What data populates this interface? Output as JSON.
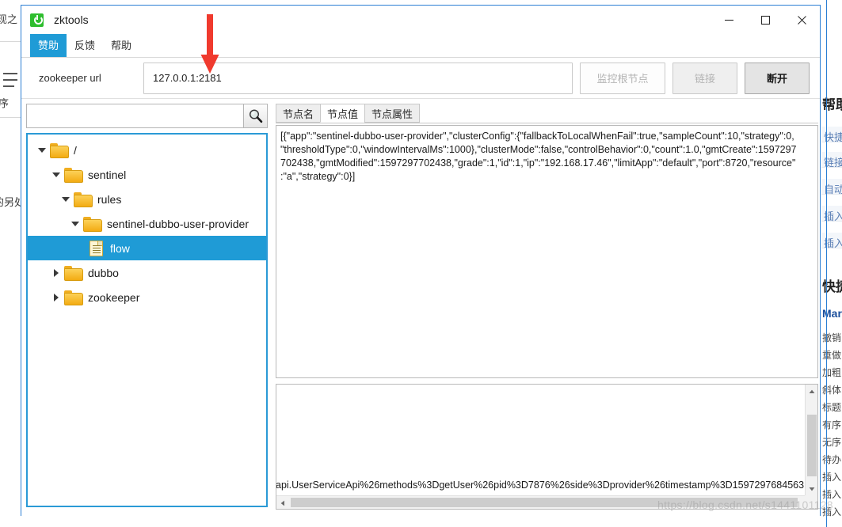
{
  "window": {
    "title": "zktools",
    "logo_icon": "zk-logo-icon",
    "controls": {
      "minimize": "minimize-icon",
      "maximize": "maximize-icon",
      "close": "close-icon"
    }
  },
  "menubar": {
    "items": [
      {
        "label": "赞助",
        "active": true
      },
      {
        "label": "反馈",
        "active": false
      },
      {
        "label": "帮助",
        "active": false
      }
    ]
  },
  "toolbar": {
    "url_label": "zookeeper url",
    "url_value": "127.0.0.1:2181",
    "url_placeholder": "",
    "watch_root_label": "监控根节点",
    "connect_label": "链接",
    "disconnect_label": "断开"
  },
  "sidebar": {
    "search_value": "",
    "search_placeholder": "",
    "search_icon": "magnifier-icon",
    "tree": [
      {
        "label": "/",
        "depth": 0,
        "type": "folder",
        "expanded": true,
        "selected": false
      },
      {
        "label": "sentinel",
        "depth": 1,
        "type": "folder",
        "expanded": true,
        "selected": false
      },
      {
        "label": "rules",
        "depth": 2,
        "type": "folder",
        "expanded": true,
        "selected": false
      },
      {
        "label": "sentinel-dubbo-user-provider",
        "depth": 3,
        "type": "folder",
        "expanded": true,
        "selected": false
      },
      {
        "label": "flow",
        "depth": 4,
        "type": "file",
        "expanded": false,
        "selected": true
      },
      {
        "label": "dubbo",
        "depth": 1,
        "type": "folder",
        "expanded": false,
        "selected": false
      },
      {
        "label": "zookeeper",
        "depth": 1,
        "type": "folder",
        "expanded": false,
        "selected": false
      }
    ]
  },
  "content": {
    "tabs": [
      {
        "label": "节点名",
        "active": false
      },
      {
        "label": "节点值",
        "active": true
      },
      {
        "label": "节点属性",
        "active": false
      }
    ],
    "node_value": "[{\"app\":\"sentinel-dubbo-user-provider\",\"clusterConfig\":{\"fallbackToLocalWhenFail\":true,\"sampleCount\":10,\"strategy\":0,\n\"thresholdType\":0,\"windowIntervalMs\":1000},\"clusterMode\":false,\"controlBehavior\":0,\"count\":1.0,\"gmtCreate\":1597297\n702438,\"gmtModified\":1597297702438,\"grade\":1,\"id\":1,\"ip\":\"192.168.17.46\",\"limitApp\":\"default\",\"port\":8720,\"resource\"\n:\"a\",\"strategy\":0}]",
    "bottom_text": "api.UserServiceApi%26methods%3DgetUser%26pid%3D7876%26side%3Dprovider%26timestamp%3D1597297684563"
  },
  "annotation": {
    "arrow_color": "#f03a2e",
    "arrow_name": "red-down-arrow"
  },
  "watermark": "https://blog.csdn.net/s1441101128",
  "background_left": {
    "lines": [
      "现之",
      "序",
      "的另处"
    ]
  },
  "background_right": {
    "title": "帮助",
    "links": [
      "快捷",
      "链接",
      "自动",
      "插入",
      "插入"
    ],
    "subtitle": "快捷",
    "section": "Markdown",
    "rows": [
      "撤销",
      "重做",
      "加粗",
      "斜体",
      "标题",
      "有序",
      "无序",
      "待办",
      "插入",
      "插入",
      "插入"
    ]
  },
  "colors": {
    "accent": "#1f9bd6",
    "window_border": "#2b7fd4",
    "folder": "#f3ab13",
    "selection": "#1f9bd6"
  }
}
